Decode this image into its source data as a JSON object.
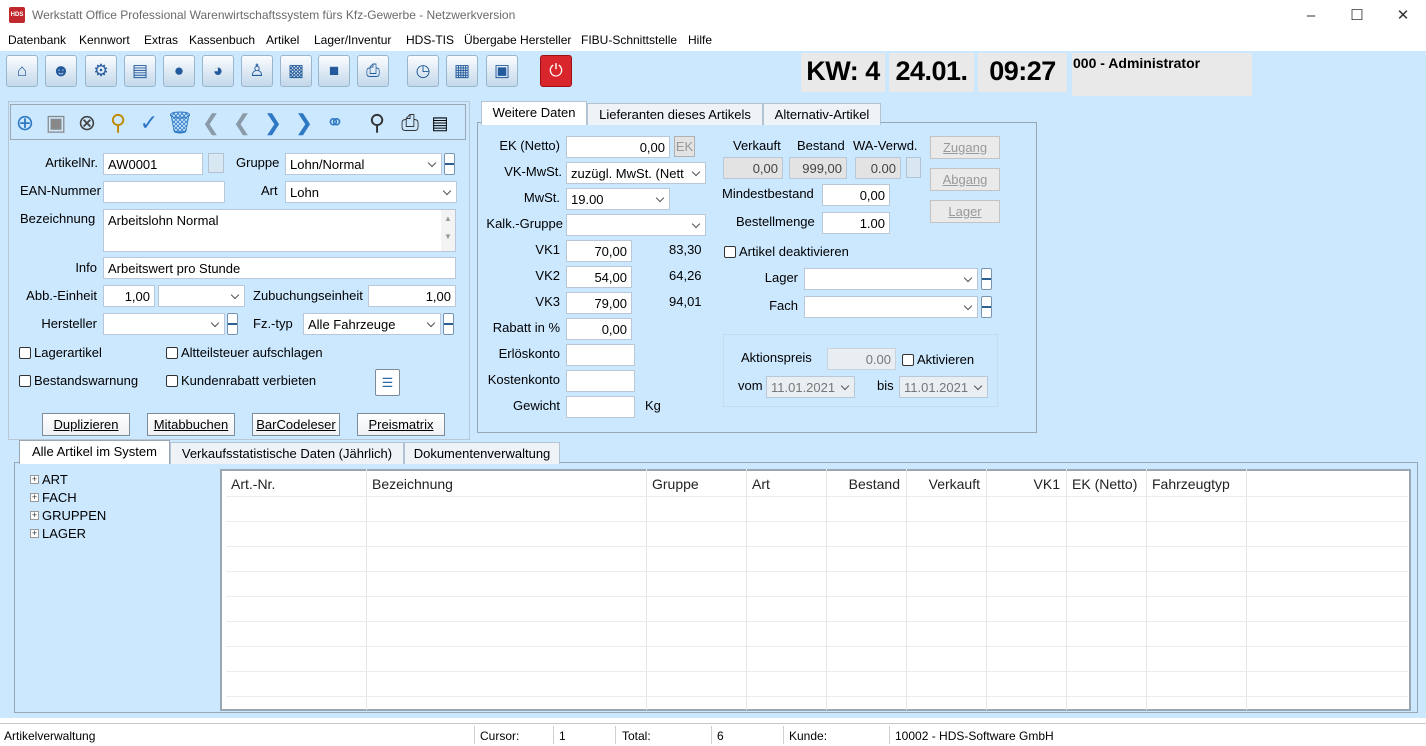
{
  "window": {
    "title": "Werkstatt Office Professional Warenwirtschaftssystem fürs Kfz-Gewerbe - Netzwerkversion",
    "app_icon_text": "HDS"
  },
  "menu": [
    "Datenbank",
    "Kennwort",
    "Extras",
    "Kassenbuch",
    "Artikel",
    "Lager/Inventur",
    "HDS-TIS",
    "Übergabe Hersteller",
    "FIBU-Schnittstelle",
    "Hilfe"
  ],
  "toolbar_icons": [
    "home-icon",
    "users-icon",
    "settings-gear-icon",
    "documents-icon",
    "globe-icon",
    "pie-chart-icon",
    "person-icon",
    "bar-chart-icon",
    "car-icon",
    "printer-icon",
    "clock-icon",
    "calendar-icon",
    "package-icon",
    "power-icon"
  ],
  "header": {
    "kw": "KW: 4",
    "date": "24.01.",
    "time": "09:27",
    "user": "000 - Administrator"
  },
  "article": {
    "artikelnr_label": "ArtikelNr.",
    "artikelnr": "AW0001",
    "gruppe_label": "Gruppe",
    "gruppe": "Lohn/Normal",
    "ean_label": "EAN-Nummer",
    "ean": "",
    "art_label": "Art",
    "art": "Lohn",
    "bezeichnung_label": "Bezeichnung",
    "bezeichnung": "Arbeitslohn Normal",
    "info_label": "Info",
    "info": "Arbeitswert pro Stunde",
    "abb_label": "Abb.-Einheit",
    "abb": "1,00",
    "abb_unit": "",
    "zubuchung_label": "Zubuchungseinheit",
    "zubuchung": "1,00",
    "hersteller_label": "Hersteller",
    "hersteller": "",
    "fztyp_label": "Fz.-typ",
    "fztyp": "Alle Fahrzeuge",
    "lagerartikel": "Lagerartikel",
    "altteilsteuer": "Altteilsteuer aufschlagen",
    "bestandswarnung": "Bestandswarnung",
    "kundenrabatt": "Kundenrabatt verbieten"
  },
  "buttons": {
    "duplizieren": "Duplizieren",
    "mitabbuchen": "Mitabbuchen",
    "barcodeleser": "BarCodeleser",
    "preismatrix": "Preismatrix"
  },
  "tabs_top": [
    "Weitere Daten",
    "Lieferanten dieses Artikels",
    "Alternativ-Artikel"
  ],
  "prices": {
    "ek_label": "EK (Netto)",
    "ek": "0,00",
    "ek_btn": "EK",
    "vkmwst_label": "VK-MwSt.",
    "vkmwst": "zuzügl. MwSt. (Nett",
    "mwst_label": "MwSt.",
    "mwst": "19.00",
    "kalk_label": "Kalk.-Gruppe",
    "kalk": "",
    "vk1_label": "VK1",
    "vk1": "70,00",
    "vk1_brutto": "83,30",
    "vk2_label": "VK2",
    "vk2": "54,00",
    "vk2_brutto": "64,26",
    "vk3_label": "VK3",
    "vk3": "79,00",
    "vk3_brutto": "94,01",
    "rabatt_label": "Rabatt in %",
    "rabatt": "0,00",
    "erloes_label": "Erlöskonto",
    "erloes": "",
    "kosten_label": "Kostenkonto",
    "kosten": "",
    "gewicht_label": "Gewicht",
    "gewicht": "",
    "gewicht_unit": "Kg"
  },
  "stock": {
    "verkauft_label": "Verkauft",
    "verkauft": "0,00",
    "bestand_label": "Bestand",
    "bestand": "999,00",
    "waverwd_label": "WA-Verwd.",
    "waverwd": "0.00",
    "zugang": "Zugang",
    "abgang": "Abgang",
    "lager_btn": "Lager",
    "mindest_label": "Mindestbestand",
    "mindest": "0,00",
    "bestell_label": "Bestellmenge",
    "bestell": "1.00",
    "deaktivieren": "Artikel deaktivieren",
    "lager_label": "Lager",
    "lager": "",
    "fach_label": "Fach",
    "fach": ""
  },
  "aktion": {
    "label": "Aktionspreis",
    "preis": "0.00",
    "aktivieren": "Aktivieren",
    "vom_label": "vom",
    "vom": "11.01.2021",
    "bis_label": "bis",
    "bis": "11.01.2021"
  },
  "tabs_bottom": [
    "Alle Artikel im System",
    "Verkaufsstatistische Daten (Jährlich)",
    "Dokumentenverwaltung"
  ],
  "tree": [
    "ART",
    "FACH",
    "GRUPPEN",
    "LAGER"
  ],
  "table": {
    "columns": [
      "Art.-Nr.",
      "Bezeichnung",
      "Gruppe",
      "Art",
      "Bestand",
      "Verkauft",
      "VK1",
      "EK (Netto)",
      "Fahrzeugtyp"
    ],
    "rows": []
  },
  "status": {
    "module": "Artikelverwaltung",
    "cursor_label": "Cursor:",
    "cursor": "1",
    "total_label": "Total:",
    "total": "6",
    "kunde_label": "Kunde:",
    "kunde": "10002 - HDS-Software GmbH"
  }
}
